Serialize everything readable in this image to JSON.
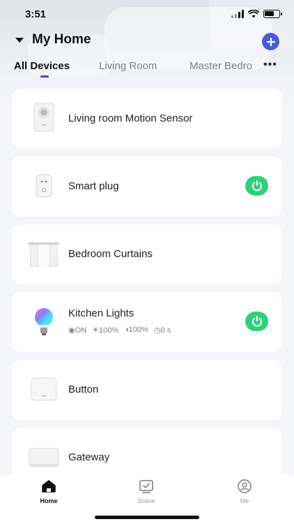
{
  "status_bar": {
    "time": "3:51"
  },
  "header": {
    "title": "My Home",
    "add_icon": "plus-icon"
  },
  "tabs": [
    {
      "label": "All Devices",
      "active": true
    },
    {
      "label": "Living Room",
      "active": false
    },
    {
      "label": "Master Bedro",
      "active": false
    }
  ],
  "more_label": "•••",
  "devices": [
    {
      "name": "Living room Motion Sensor",
      "icon": "motion-sensor-icon"
    },
    {
      "name": "Smart plug",
      "icon": "smart-plug-icon",
      "power": true
    },
    {
      "name": "Bedroom Curtains",
      "icon": "curtains-icon"
    },
    {
      "name": "Kitchen Lights",
      "icon": "light-bulb-icon",
      "power": true,
      "status": {
        "on": "ON",
        "brightness": "100%",
        "contrast": "100%",
        "timer": "0 s"
      }
    },
    {
      "name": "Button",
      "icon": "button-icon"
    },
    {
      "name": "Gateway",
      "icon": "gateway-icon"
    }
  ],
  "tab_bar": [
    {
      "label": "Home",
      "icon": "home-icon",
      "active": true
    },
    {
      "label": "Scene",
      "icon": "scene-icon",
      "active": false
    },
    {
      "label": "Me",
      "icon": "profile-icon",
      "active": false
    }
  ],
  "colors": {
    "accent": "#4a5bd4",
    "power_on": "#2fd07a",
    "tab_indicator": "#3a4bd0"
  }
}
